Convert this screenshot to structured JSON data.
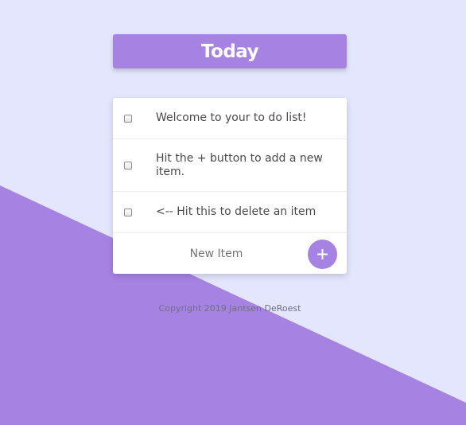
{
  "header": {
    "title": "Today"
  },
  "todo": {
    "items": [
      {
        "text": "Welcome to your to do list!",
        "checked": false
      },
      {
        "text": "Hit the + button to add a new item.",
        "checked": false
      },
      {
        "text": "<-- Hit this to delete an item",
        "checked": false
      }
    ],
    "new_item_placeholder": "New Item",
    "add_button_label": "+"
  },
  "footer": {
    "copyright": "Copyright 2019 Jantsen DeRoest"
  },
  "colors": {
    "background": "#E3E6FD",
    "accent": "#A683E3",
    "card": "#FFFFFF",
    "text": "#4A4A4A"
  },
  "icons": {
    "add": "plus-icon"
  }
}
